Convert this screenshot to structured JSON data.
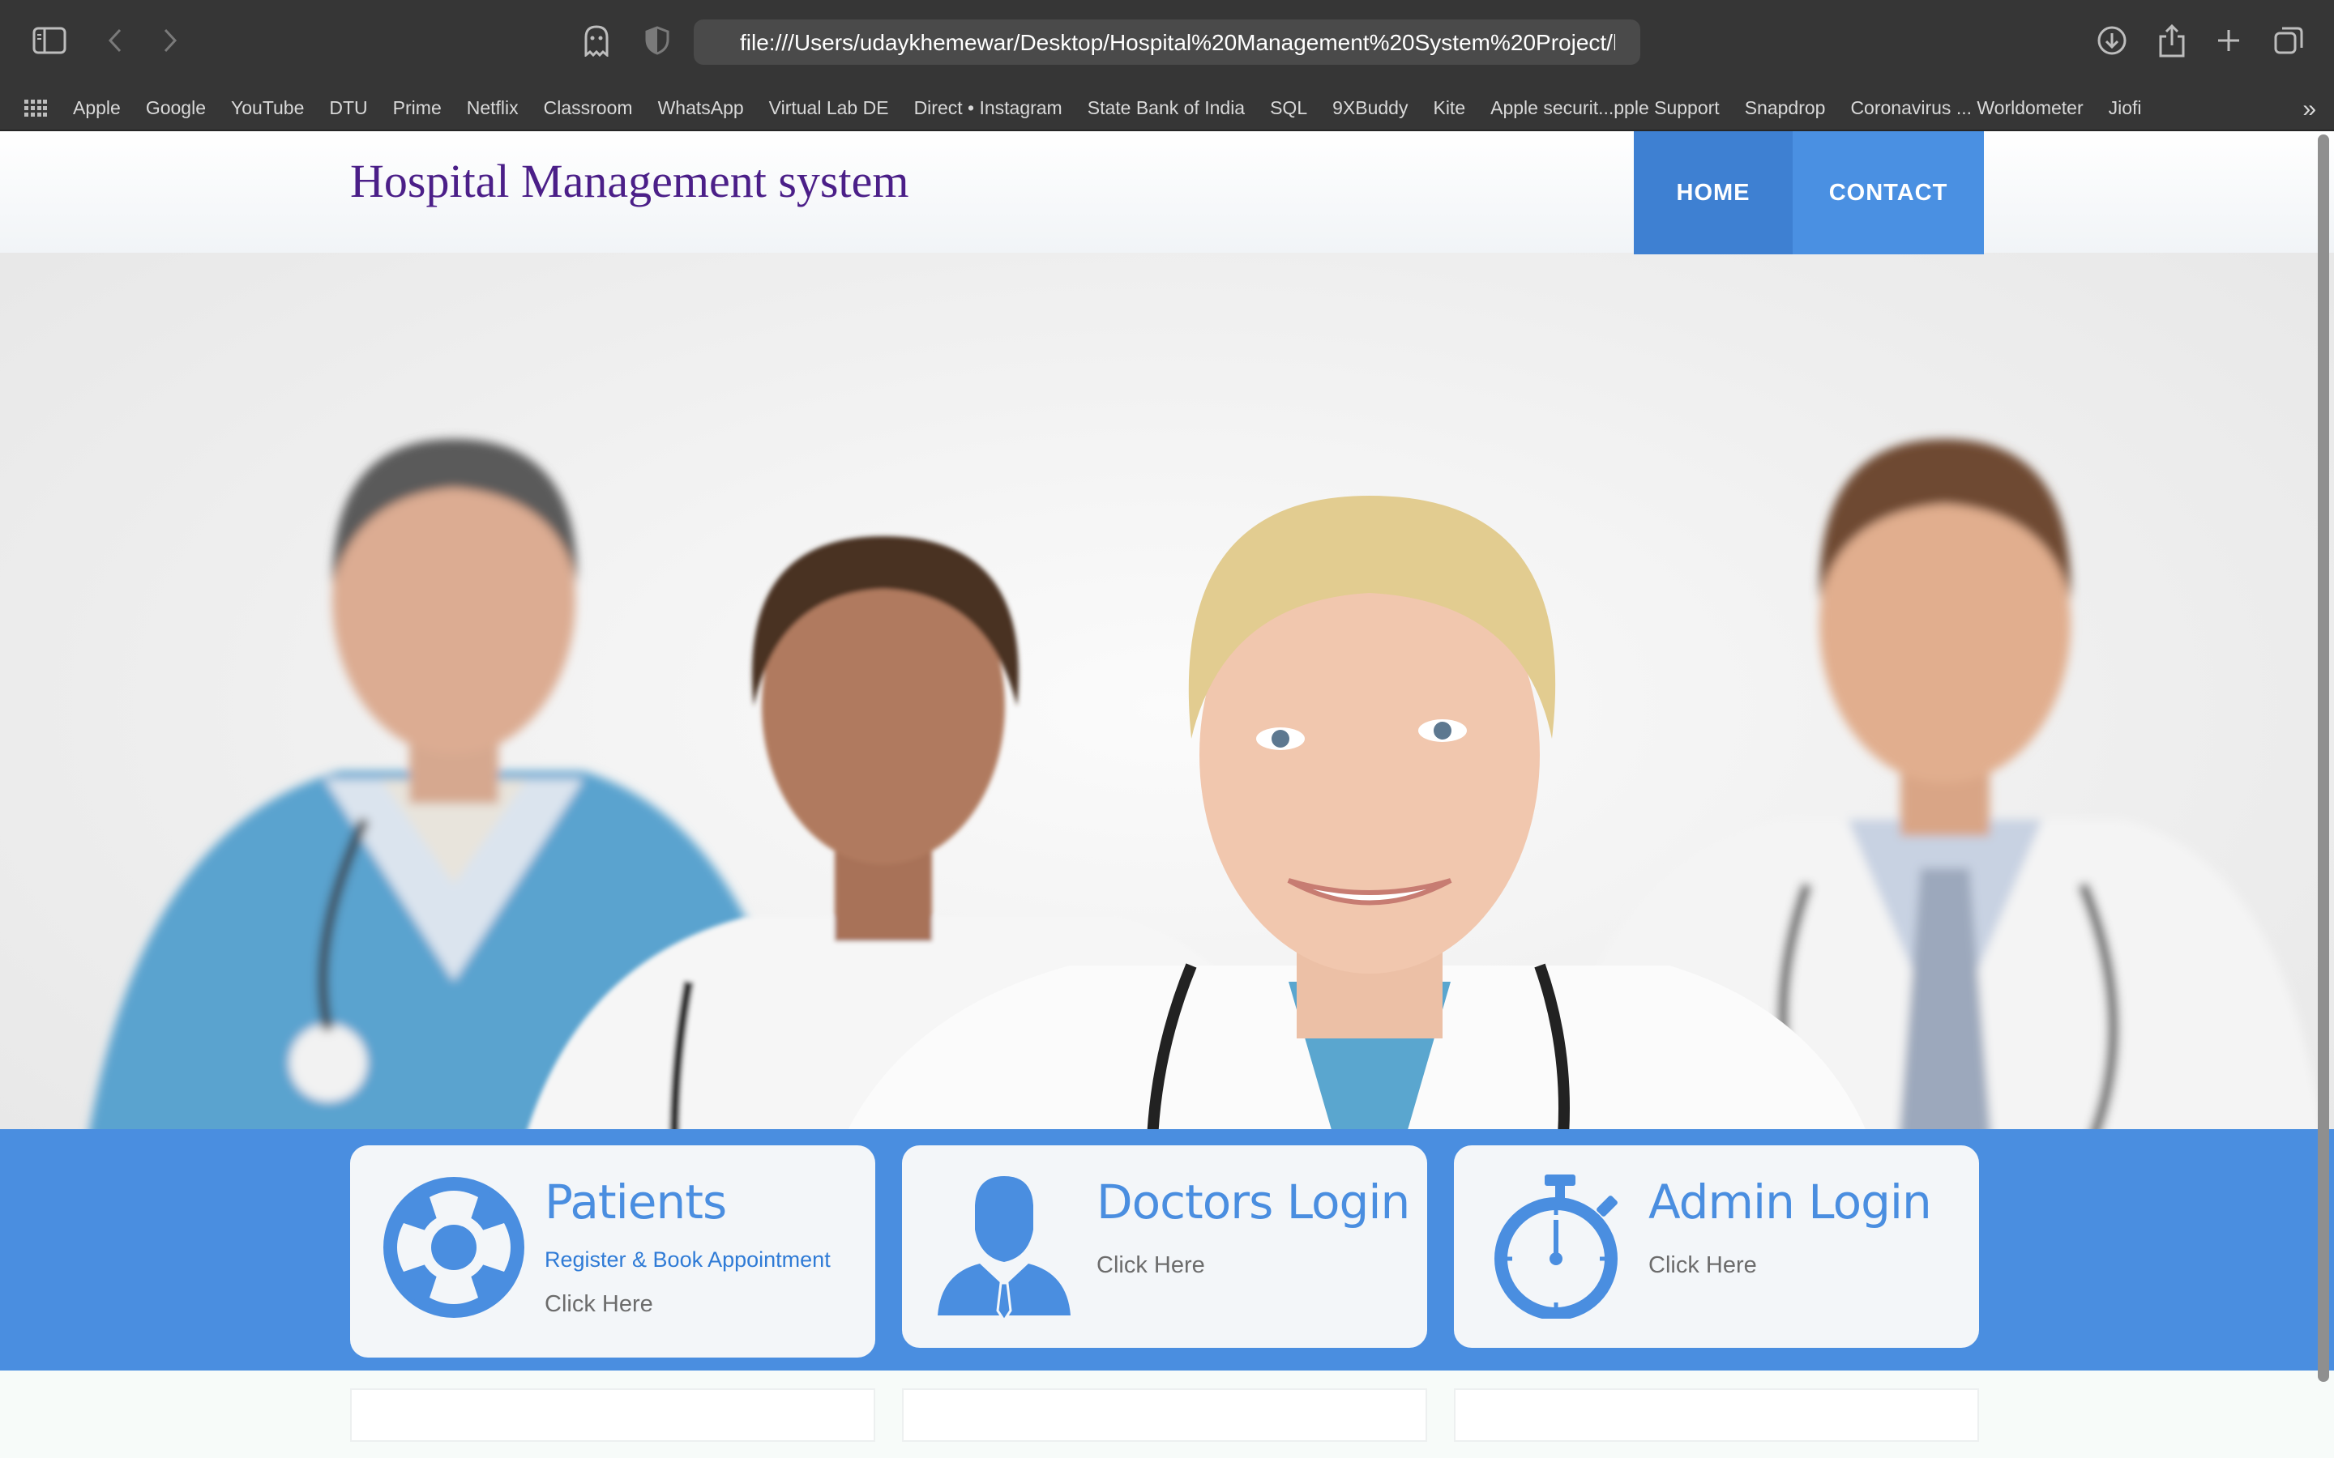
{
  "browser": {
    "url": "file:///Users/udaykhemewar/Desktop/Hospital%20Management%20System%20Project/hosp",
    "bookmarks": [
      "Apple",
      "Google",
      "YouTube",
      "DTU",
      "Prime",
      "Netflix",
      "Classroom",
      "WhatsApp",
      "Virtual Lab DE",
      "Direct • Instagram",
      "State Bank of India",
      "SQL",
      "9XBuddy",
      "Kite",
      "Apple securit...pple Support",
      "Snapdrop",
      "Coronavirus ... Worldometer",
      "Jiofi"
    ],
    "more_glyph": "»"
  },
  "site": {
    "title": "Hospital Management system",
    "nav": {
      "home": "HOME",
      "contact": "CONTACT"
    }
  },
  "cards": [
    {
      "title": "Patients",
      "subtitle": "Register & Book Appointment",
      "link": "Click Here",
      "icon": "lifebuoy-icon"
    },
    {
      "title": "Doctors Login",
      "link": "Click Here",
      "icon": "doctor-icon"
    },
    {
      "title": "Admin Login",
      "link": "Click Here",
      "icon": "stopwatch-icon"
    }
  ],
  "colors": {
    "brand_blue": "#4a8ee0",
    "nav_active": "#3e80d2",
    "title_purple": "#4b1f88",
    "chrome": "#363636"
  }
}
